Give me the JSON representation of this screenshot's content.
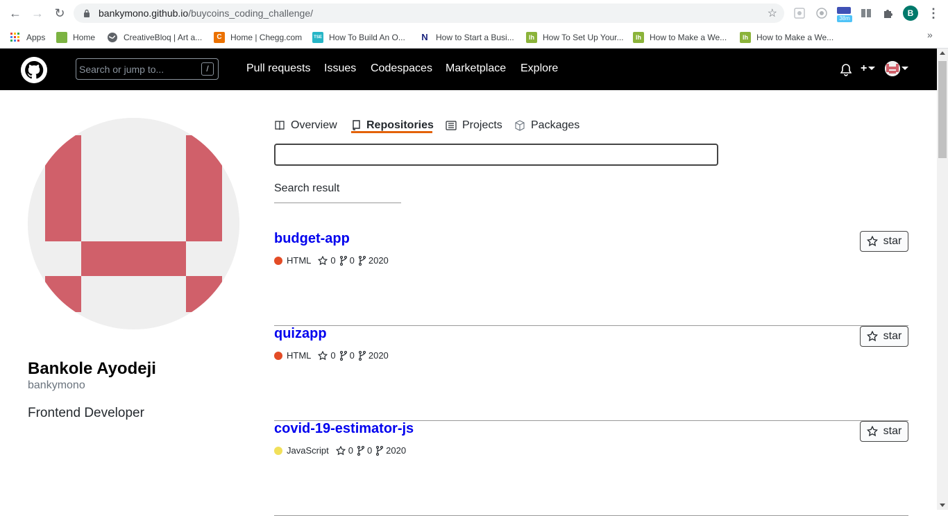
{
  "browser": {
    "url_host": "bankymono.github.io",
    "url_path": "/buycoins_coding_challenge/",
    "profile_initial": "B",
    "ext_badge": "38m",
    "bookmarks": [
      {
        "label": "Apps",
        "icon": "apps-grid-icon",
        "color": "#ea4335"
      },
      {
        "label": "Home",
        "icon": "android-icon",
        "color": "#7cb342"
      },
      {
        "label": "CreativeBloq | Art a...",
        "icon": "globe-icon",
        "color": "#5f6368"
      },
      {
        "label": "Home | Chegg.com",
        "icon": "chegg-icon",
        "color": "#eb7100"
      },
      {
        "label": "How To Build An O...",
        "icon": "tse-icon",
        "color": "#26b5c6"
      },
      {
        "label": "How to Start a Busi...",
        "icon": "n-icon",
        "color": "#1a237e"
      },
      {
        "label": "How To Set Up Your...",
        "icon": "lh-icon",
        "color": "#8bb33a"
      },
      {
        "label": "How to Make a We...",
        "icon": "lh-icon",
        "color": "#8bb33a"
      },
      {
        "label": "How to Make a We...",
        "icon": "lh-icon",
        "color": "#8bb33a"
      }
    ],
    "more": "»"
  },
  "header": {
    "search_placeholder": "Search or jump to...",
    "slash_key": "/",
    "nav": [
      "Pull requests",
      "Issues",
      "Codespaces",
      "Marketplace",
      "Explore"
    ],
    "plus": "+"
  },
  "profile": {
    "name": "Bankole Ayodeji",
    "login": "bankymono",
    "bio": "Frontend Developer",
    "avatar_color": "#d0606a"
  },
  "tabs": [
    {
      "label": "Overview",
      "icon": "book-icon",
      "active": false
    },
    {
      "label": "Repositories",
      "icon": "repo-icon",
      "active": true
    },
    {
      "label": "Projects",
      "icon": "project-icon",
      "active": false
    },
    {
      "label": "Packages",
      "icon": "package-icon",
      "active": false
    }
  ],
  "repo_search": {
    "value": ""
  },
  "search_result_label": "Search result",
  "repos": [
    {
      "name": "budget-app",
      "language": "HTML",
      "lang_color": "#e34c26",
      "stars": "0",
      "forks": "0",
      "year": "2020",
      "star_label": "star"
    },
    {
      "name": "quizapp",
      "language": "HTML",
      "lang_color": "#e34c26",
      "stars": "0",
      "forks": "0",
      "year": "2020",
      "star_label": "star"
    },
    {
      "name": "covid-19-estimator-js",
      "language": "JavaScript",
      "lang_color": "#f1e05a",
      "stars": "0",
      "forks": "0",
      "year": "2020",
      "star_label": "star"
    }
  ]
}
